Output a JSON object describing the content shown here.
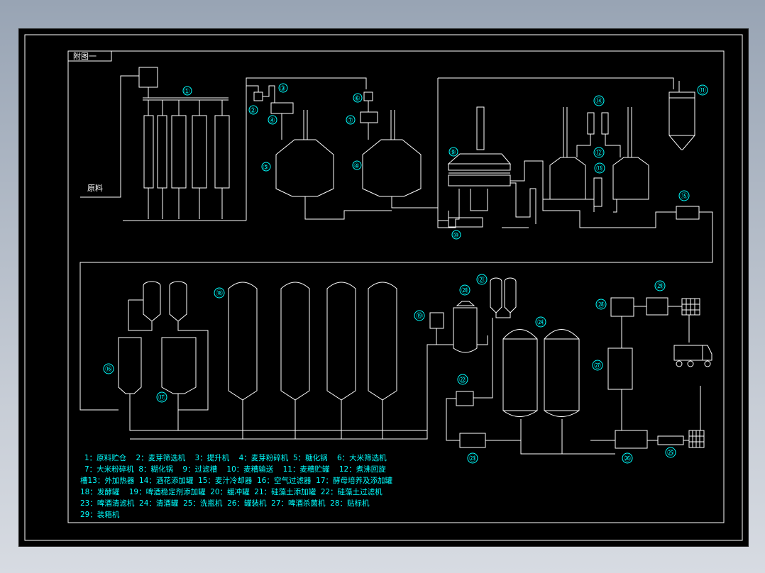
{
  "drawing": {
    "title": "附图一",
    "raw_material_label": "原料",
    "markers": [
      "①",
      "②",
      "③",
      "④",
      "⑤",
      "⑥",
      "⑦",
      "⑧",
      "⑨",
      "⑩",
      "⑪",
      "⑫",
      "⑬",
      "⑭",
      "⑮",
      "⑯",
      "⑰",
      "⑱",
      "⑲",
      "⑳",
      "㉑",
      "㉒",
      "㉓",
      "㉔",
      "㉕",
      "㉖",
      "㉗",
      "㉘",
      "㉙"
    ],
    "marker_4_repeat": "④",
    "legend_lines": [
      "1：原料贮仓    2：麦芽筛选机    3：提升机    4：麦芽粉碎机  5：糖化锅    6：大米筛选机",
      "7：大米粉碎机  8：糊化锅    9：过滤槽    10：麦糟输送    11：麦糟贮罐    12：煮沸回旋",
      "槽13：外加热器  14：酒花添加罐  15：麦汁冷却器  16：空气过滤器  17：酵母培养及添加罐",
      "18：发酵罐    19：啤酒稳定剂添加罐  20：缓冲罐  21：硅藻土添加罐  22：硅藻土过滤机",
      "23：啤酒清滤机  24：清酒罐  25：洗瓶机  26：罐装机  27：啤酒杀菌机  28：贴标机",
      "29：装箱机"
    ]
  },
  "colors": {
    "line": "#ffffff",
    "annotation": "#00ffff",
    "background": "#000000"
  }
}
